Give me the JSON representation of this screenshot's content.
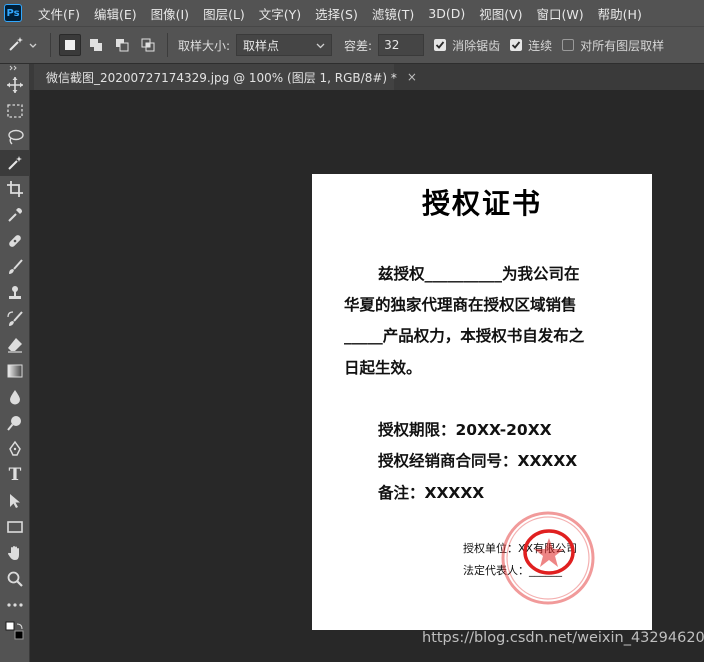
{
  "app": {
    "logo_text": "Ps",
    "menu": [
      "文件(F)",
      "编辑(E)",
      "图像(I)",
      "图层(L)",
      "文字(Y)",
      "选择(S)",
      "滤镜(T)",
      "3D(D)",
      "视图(V)",
      "窗口(W)",
      "帮助(H)"
    ]
  },
  "options": {
    "sample_size_label": "取样大小:",
    "sample_size_value": "取样点",
    "tolerance_label": "容差:",
    "tolerance_value": "32",
    "anti_alias_label": "消除锯齿",
    "anti_alias_checked": true,
    "contiguous_label": "连续",
    "contiguous_checked": true,
    "all_layers_label": "对所有图层取样",
    "all_layers_checked": false
  },
  "document_tab": {
    "title": "微信截图_20200727174329.jpg @ 100% (图层 1, RGB/8#) *",
    "close_glyph": "×"
  },
  "toolbar": {
    "tools": [
      "move",
      "marquee",
      "lasso",
      "magic-wand",
      "crop",
      "eyedropper",
      "healing",
      "brush",
      "stamp",
      "history-brush",
      "eraser",
      "gradient",
      "blur",
      "dodge",
      "pen",
      "type",
      "path-select",
      "rectangle",
      "hand",
      "zoom",
      "more"
    ],
    "active_tool": "magic-wand",
    "type_tool_glyph": "T"
  },
  "certificate": {
    "title": "授权证书",
    "para_line1": "兹授权__________为我公司在",
    "para_line2": "华夏的独家代理商在授权区域销售",
    "para_line3": "_____产品权力，本授权书自发布之",
    "para_line4": "日起生效。",
    "period": "授权期限：20XX-20XX",
    "contract": "授权经销商合同号：XXXXX",
    "note": "备注：XXXXX",
    "unit": "授权单位：XX有限公司",
    "representative": "法定代表人：______"
  },
  "watermark": "https://blog.csdn.net/weixin_43294620",
  "colors": {
    "ui_bg": "#535353",
    "canvas_bg": "#282828",
    "seal": "#e02020"
  }
}
